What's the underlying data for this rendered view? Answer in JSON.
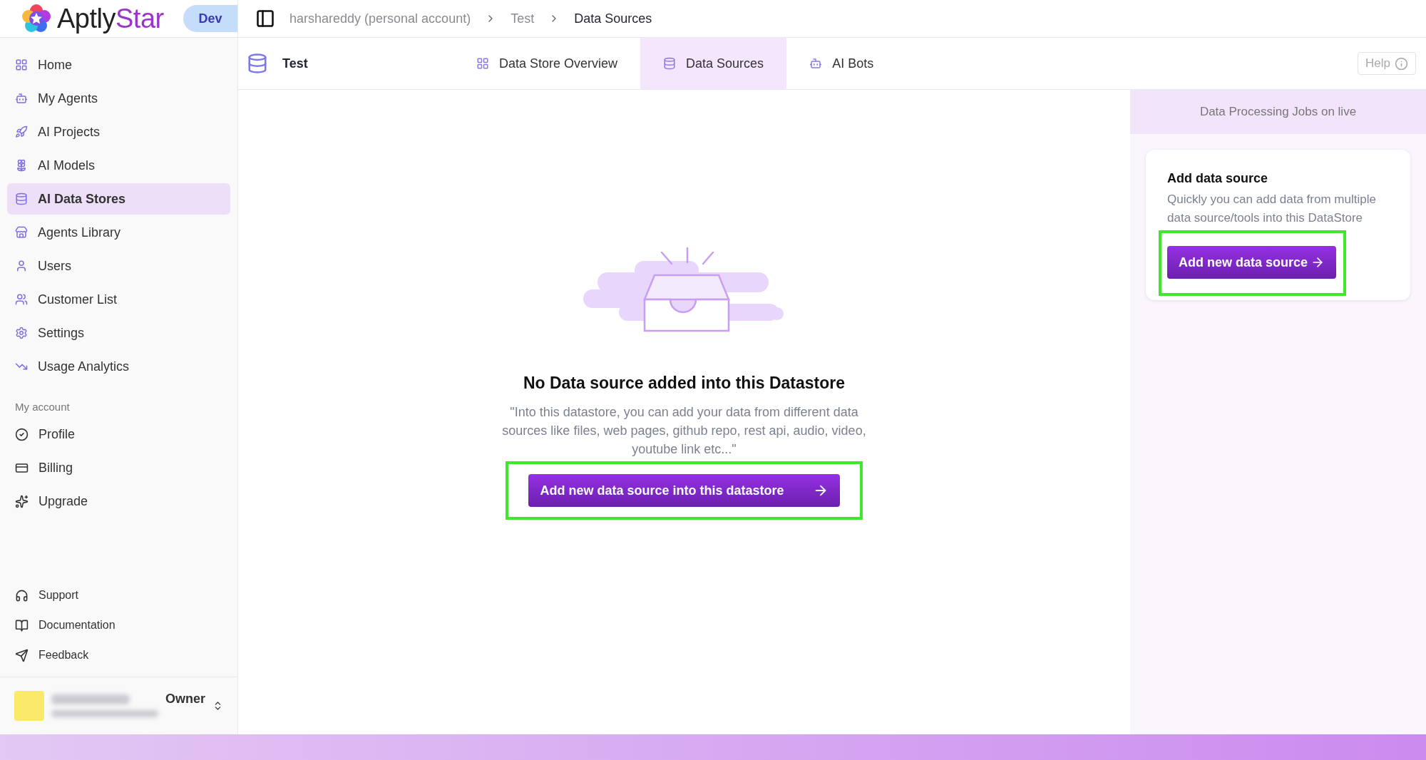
{
  "logo": {
    "text": "Aptly",
    "accent": "Star"
  },
  "env_badge": "Dev",
  "breadcrumbs": [
    {
      "label": "harshareddy (personal account)",
      "current": false
    },
    {
      "label": "Test",
      "current": false
    },
    {
      "label": "Data Sources",
      "current": true
    }
  ],
  "sidebar": {
    "items": [
      {
        "label": "Home",
        "selected": false
      },
      {
        "label": "My Agents",
        "selected": false
      },
      {
        "label": "AI Projects",
        "selected": false
      },
      {
        "label": "AI Models",
        "selected": false
      },
      {
        "label": "AI Data Stores",
        "selected": true
      },
      {
        "label": "Agents Library",
        "selected": false
      },
      {
        "label": "Users",
        "selected": false
      },
      {
        "label": "Customer List",
        "selected": false
      },
      {
        "label": "Settings",
        "selected": false
      },
      {
        "label": "Usage Analytics",
        "selected": false
      }
    ],
    "account_heading": "My account",
    "account_items": [
      {
        "label": "Profile"
      },
      {
        "label": "Billing"
      },
      {
        "label": "Upgrade"
      }
    ],
    "footer_items": [
      {
        "label": "Support"
      },
      {
        "label": "Documentation"
      },
      {
        "label": "Feedback"
      }
    ],
    "user": {
      "role": "Owner"
    }
  },
  "datastore_title": "Test",
  "tabs": [
    {
      "label": "Data Store Overview",
      "selected": false
    },
    {
      "label": "Data Sources",
      "selected": true
    },
    {
      "label": "AI Bots",
      "selected": false
    }
  ],
  "help_button": "Help",
  "empty_state": {
    "title": "No Data source added into this Datastore",
    "description": "\"Into this datastore, you can add your data from different data sources like files, web pages, github repo, rest api, audio, video, youtube link etc...\"",
    "button": {
      "label": "Add new data source into this datastore",
      "highlighted": true
    }
  },
  "side_panel": {
    "header": "Data Processing Jobs on live",
    "card": {
      "title": "Add data source",
      "description": "Quickly you can add data from multiple data source/tools into this DataStore",
      "button": {
        "label": "Add new data source",
        "highlighted": true
      }
    }
  }
}
